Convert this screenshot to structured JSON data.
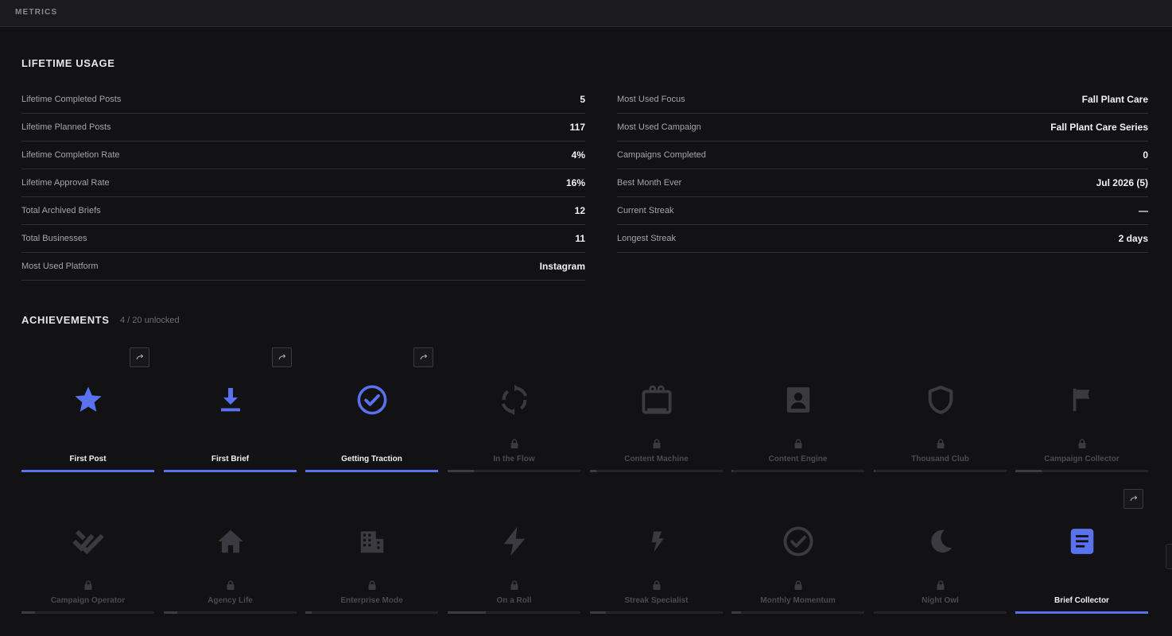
{
  "header": {
    "title": "METRICS"
  },
  "lifetime": {
    "title": "LIFETIME USAGE",
    "left": [
      {
        "label": "Lifetime Completed Posts",
        "value": "5"
      },
      {
        "label": "Lifetime Planned Posts",
        "value": "117"
      },
      {
        "label": "Lifetime Completion Rate",
        "value": "4%"
      },
      {
        "label": "Lifetime Approval Rate",
        "value": "16%"
      },
      {
        "label": "Total Archived Briefs",
        "value": "12"
      },
      {
        "label": "Total Businesses",
        "value": "11"
      },
      {
        "label": "Most Used Platform",
        "value": "Instagram"
      }
    ],
    "right": [
      {
        "label": "Most Used Focus",
        "value": "Fall Plant Care"
      },
      {
        "label": "Most Used Campaign",
        "value": "Fall Plant Care Series"
      },
      {
        "label": "Campaigns Completed",
        "value": "0"
      },
      {
        "label": "Best Month Ever",
        "value": "Jul 2026 (5)"
      },
      {
        "label": "Current Streak",
        "value": "—"
      },
      {
        "label": "Longest Streak",
        "value": "2 days"
      }
    ]
  },
  "achievements": {
    "title": "ACHIEVEMENTS",
    "count_text": "4 / 20 unlocked",
    "colors": {
      "accent": "#5b72f0",
      "locked_icon": "#3a3a40"
    },
    "items": [
      {
        "name": "First Post",
        "icon": "star-icon",
        "unlocked": true,
        "progress": 1.0,
        "share": true
      },
      {
        "name": "First Brief",
        "icon": "download-icon",
        "unlocked": true,
        "progress": 1.0,
        "share": true
      },
      {
        "name": "Getting Traction",
        "icon": "check-circle-icon",
        "unlocked": true,
        "progress": 1.0,
        "share": true
      },
      {
        "name": "In the Flow",
        "icon": "refresh-icon",
        "unlocked": false,
        "progress": 0.2,
        "share": false
      },
      {
        "name": "Content Machine",
        "icon": "tv-icon",
        "unlocked": false,
        "progress": 0.05,
        "share": false
      },
      {
        "name": "Content Engine",
        "icon": "portrait-icon",
        "unlocked": false,
        "progress": 0.01,
        "share": false
      },
      {
        "name": "Thousand Club",
        "icon": "shield-icon",
        "unlocked": false,
        "progress": 0.01,
        "share": false
      },
      {
        "name": "Campaign Collector",
        "icon": "flag-icon",
        "unlocked": false,
        "progress": 0.2,
        "share": false
      },
      {
        "name": "Campaign Operator",
        "icon": "double-check-icon",
        "unlocked": false,
        "progress": 0.1,
        "share": false
      },
      {
        "name": "Agency Life",
        "icon": "home-icon",
        "unlocked": false,
        "progress": 0.1,
        "share": false
      },
      {
        "name": "Enterprise Mode",
        "icon": "building-icon",
        "unlocked": false,
        "progress": 0.05,
        "share": false
      },
      {
        "name": "On a Roll",
        "icon": "bolt-icon",
        "unlocked": false,
        "progress": 0.29,
        "share": false
      },
      {
        "name": "Streak Specialist",
        "icon": "bolt-small-icon",
        "unlocked": false,
        "progress": 0.12,
        "share": false
      },
      {
        "name": "Monthly Momentum",
        "icon": "check-circle-outline-icon",
        "unlocked": false,
        "progress": 0.07,
        "share": false
      },
      {
        "name": "Night Owl",
        "icon": "moon-icon",
        "unlocked": false,
        "progress": 0.0,
        "share": false
      },
      {
        "name": "Brief Collector",
        "icon": "document-icon",
        "unlocked": true,
        "progress": 1.0,
        "share": true
      }
    ]
  }
}
